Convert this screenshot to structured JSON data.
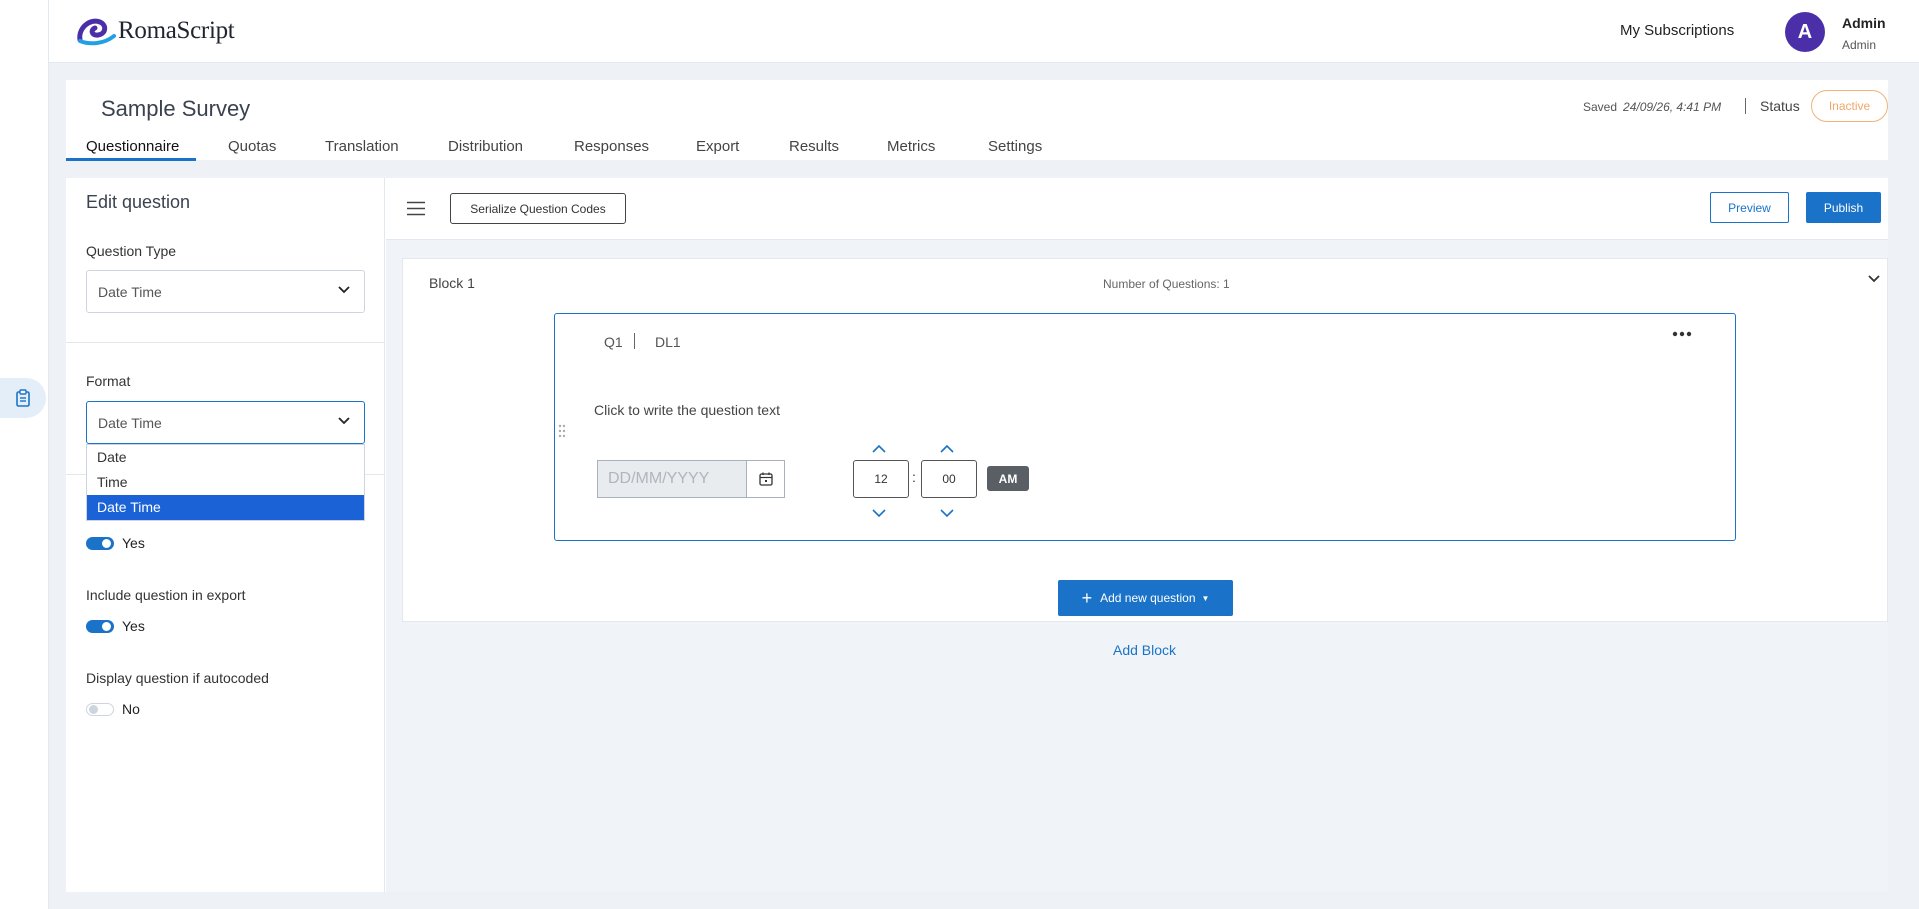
{
  "app": {
    "logo_text": "RomaScript",
    "my_subscriptions": "My Subscriptions",
    "user": {
      "initial": "A",
      "name": "Admin",
      "role": "Admin"
    }
  },
  "survey": {
    "title": "Sample Survey",
    "saved_label": "Saved",
    "saved_time": "24/09/26, 4:41 PM",
    "status_label": "Status",
    "status_value": "Inactive",
    "tabs": [
      {
        "label": "Questionnaire",
        "active": true
      },
      {
        "label": "Quotas"
      },
      {
        "label": "Translation"
      },
      {
        "label": "Distribution"
      },
      {
        "label": "Responses"
      },
      {
        "label": "Export"
      },
      {
        "label": "Results"
      },
      {
        "label": "Metrics"
      },
      {
        "label": "Settings"
      }
    ]
  },
  "editor": {
    "title": "Edit question",
    "question_type_label": "Question Type",
    "question_type_value": "Date Time",
    "format_label": "Format",
    "format_value": "Date Time",
    "format_options": [
      "Date",
      "Time",
      "Date Time"
    ],
    "format_selected": "Date Time",
    "toggle1": {
      "value": "Yes",
      "on": true
    },
    "include_export_label": "Include question in export",
    "include_export": {
      "value": "Yes",
      "on": true
    },
    "display_autocoded_label": "Display question if autocoded",
    "display_autocoded": {
      "value": "No",
      "on": false
    }
  },
  "toolbar": {
    "serialize_label": "Serialize Question Codes",
    "preview_label": "Preview",
    "publish_label": "Publish"
  },
  "block": {
    "title": "Block 1",
    "count_text": "Number of Questions: 1",
    "question": {
      "number": "Q1",
      "code": "DL1",
      "text": "Click to write the question text",
      "date_placeholder": "DD/MM/YYYY",
      "hour": "12",
      "minute": "00",
      "ampm": "AM"
    },
    "add_question_label": "Add new question",
    "add_block_label": "Add Block"
  },
  "colors": {
    "accent": "#1a73c8",
    "avatar": "#4b2fa8",
    "status_inactive": "#f0a868"
  }
}
